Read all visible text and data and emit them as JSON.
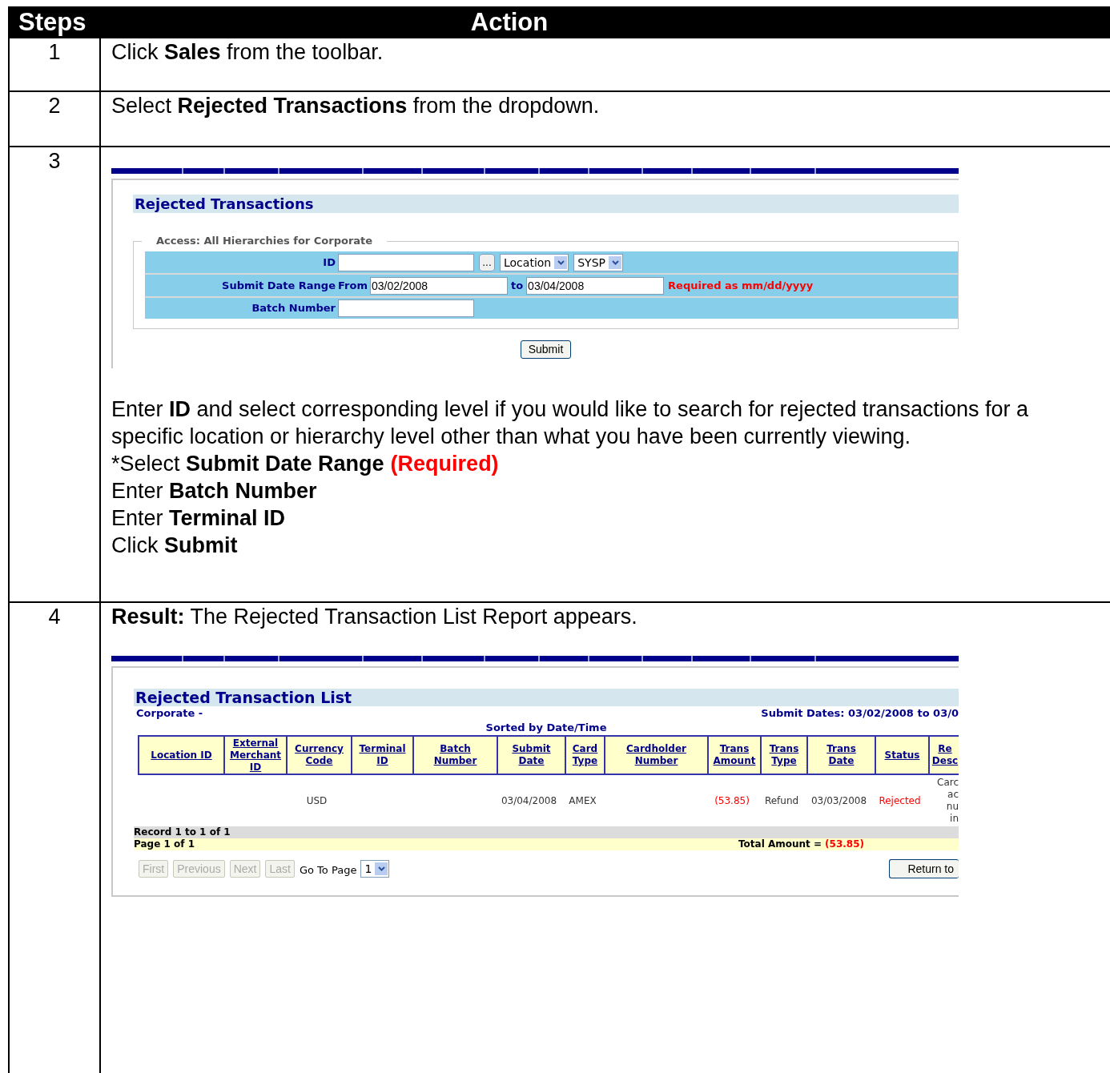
{
  "table": {
    "columns": [
      "Steps",
      "Action"
    ],
    "rows": [
      {
        "step": "1",
        "kind": "text",
        "text": "Click **Sales** from the toolbar."
      },
      {
        "step": "2",
        "kind": "text",
        "text": "Select **Rejected Transactions** from the dropdown."
      },
      {
        "step": "3",
        "kind": "form",
        "form": {
          "title": "Rejected Transactions",
          "legend": "Access: All Hierarchies for Corporate",
          "id_label": "ID",
          "browse_button": "...",
          "level_select": "Location",
          "system_select": "SYSP",
          "date_label": "Submit Date Range",
          "from_label": "From",
          "from_value": "03/02/2008",
          "to_label": "to",
          "to_value": "03/04/2008",
          "date_hint": "Required as mm/dd/yyyy",
          "batch_label": "Batch Number",
          "submit": "Submit"
        },
        "instructions": [
          {
            "text": "Enter **ID** and select corresponding level if you would like to search for rejected transactions for a specific location or hierarchy level other than what you have been currently viewing."
          },
          {
            "text": "*Select **Submit Date Range**",
            "note": "(Required)"
          },
          {
            "text": "Enter **Batch Number**"
          },
          {
            "text": "Enter **Terminal ID**"
          },
          {
            "text": "Click **Submit**"
          }
        ]
      },
      {
        "step": "4",
        "kind": "result",
        "text": "**Result:** The Rejected Transaction List Report appears.",
        "report": {
          "title": "Rejected Transaction List",
          "scope": "Corporate -",
          "submit_dates": "Submit Dates: 03/02/2008 to 03/0",
          "sorted_by": "Sorted by Date/Time",
          "columns": [
            "Location ID",
            "External\nMerchant\nID",
            "Currency\nCode",
            "Terminal\nID",
            "Batch\nNumber",
            "Submit\nDate",
            "Card\nType",
            "Cardholder\nNumber",
            "Trans\nAmount",
            "Trans\nType",
            "Trans\nDate",
            "Status",
            "Re\nDesc"
          ],
          "rows": [
            {
              "cells": [
                null,
                null,
                {
                  "text": "USD",
                  "alert": false
                },
                null,
                null,
                {
                  "text": "03/04/2008",
                  "alert": false
                },
                {
                  "text": "AMEX",
                  "alert": false
                },
                null,
                {
                  "text": "(53.85)",
                  "alert": true
                },
                {
                  "text": "Refund",
                  "alert": false
                },
                {
                  "text": "03/03/2008",
                  "alert": false
                },
                {
                  "text": "Rejected",
                  "alert": true
                },
                {
                  "text": "Carc\nac\nnu\nin",
                  "alert": false
                }
              ]
            }
          ],
          "record_info": "Record 1 to 1 of 1",
          "page_info": "Page 1 of 1",
          "total_label": "Total Amount =",
          "total_value": "(53.85)",
          "pager": [
            {
              "label": "First",
              "disabled": true
            },
            {
              "label": "Previous",
              "disabled": true
            },
            {
              "label": "Next",
              "disabled": true
            },
            {
              "label": "Last",
              "disabled": true
            }
          ],
          "goto_label": "Go To Page",
          "goto_value": "1",
          "return_button": "Return to"
        }
      }
    ]
  }
}
